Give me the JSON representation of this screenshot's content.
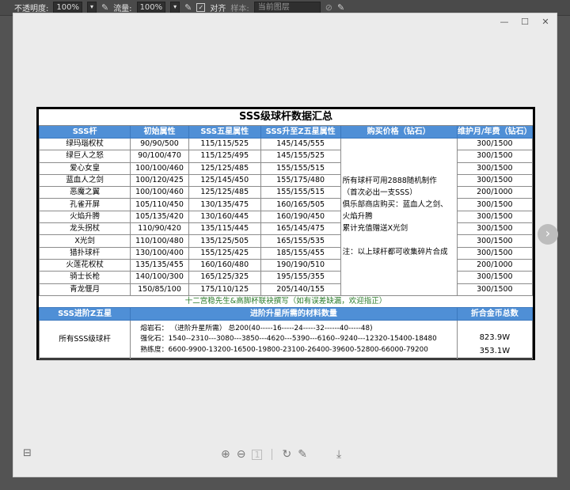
{
  "toolbar": {
    "opacity_label": "不透明度:",
    "opacity_value": "100%",
    "flow_label": "流量:",
    "flow_value": "100%",
    "align_label": "对齐",
    "sample_label": "样本:",
    "sample_value": "当前图层"
  },
  "sheet": {
    "title": "SSS级球杆数据汇总",
    "headers": [
      "SSS杆",
      "初始属性",
      "SSS五星属性",
      "SSS升至Z五星属性",
      "购买价格（钻石）",
      "维护月/年费（钻石）"
    ],
    "rows": [
      {
        "name": "绿玛瑙权杖",
        "base": "90/90/500",
        "five": "115/115/525",
        "z": "145/145/555",
        "fee": "300/1500"
      },
      {
        "name": "绿巨人之怒",
        "base": "90/100/470",
        "five": "115/125/495",
        "z": "145/155/525",
        "fee": "300/1500"
      },
      {
        "name": "爱心女皇",
        "base": "100/100/460",
        "five": "125/125/485",
        "z": "155/155/515",
        "fee": "300/1500"
      },
      {
        "name": "蓝血人之剑",
        "base": "100/120/425",
        "five": "125/145/450",
        "z": "155/175/480",
        "fee": "300/1500"
      },
      {
        "name": "恶魔之翼",
        "base": "100/100/460",
        "five": "125/125/485",
        "z": "155/155/515",
        "fee": "200/1000"
      },
      {
        "name": "孔雀开屏",
        "base": "105/110/450",
        "five": "130/135/475",
        "z": "160/165/505",
        "fee": "300/1500"
      },
      {
        "name": "火焰升腾",
        "base": "105/135/420",
        "five": "130/160/445",
        "z": "160/190/450",
        "fee": "300/1500"
      },
      {
        "name": "龙头拐杖",
        "base": "110/90/420",
        "five": "135/115/445",
        "z": "165/145/475",
        "fee": "300/1500"
      },
      {
        "name": "X光剑",
        "base": "110/100/480",
        "five": "135/125/505",
        "z": "165/155/535",
        "fee": "300/1500"
      },
      {
        "name": "猎扑球杆",
        "base": "130/100/400",
        "five": "155/125/425",
        "z": "185/155/455",
        "fee": "300/1500"
      },
      {
        "name": "火莲花权杖",
        "base": "135/135/455",
        "five": "160/160/480",
        "z": "190/190/510",
        "fee": "200/1000"
      },
      {
        "name": "骑士长枪",
        "base": "140/100/300",
        "five": "165/125/325",
        "z": "195/155/355",
        "fee": "300/1500"
      },
      {
        "name": "青龙偃月",
        "base": "150/85/100",
        "five": "175/110/125",
        "z": "205/140/155",
        "fee": "300/1500"
      }
    ],
    "price_lines": [
      "所有球杆可用2888随机制作",
      "（首次必出一支SSS）",
      "俱乐部商店购买：蓝血人之剑、",
      "火焰升腾",
      "累计充值赠送X光剑",
      "",
      "注：以上球杆都可收集碎片合成"
    ],
    "credit": "十二宫稳先生&高脚杯联袂撰写（如有误差缺漏，欢迎指正）",
    "section2_headers": [
      "SSS进阶Z五星",
      "进阶升星所需的材料数量",
      "折合金币总数"
    ],
    "section2_item": "所有SSS级球杆",
    "materials": [
      "熔岩石：   （进阶升星所需）              总200(40-----16-----24-----32------40-----48)",
      "强化石：1540--2310---3080---3850---4620---5390---6160--9240---12320-15400-18480",
      "熟练度：6600-9900-13200-16500-19800-23100-26400-39600-52800-66000-79200"
    ],
    "gold": [
      "823.9W",
      "353.1W"
    ]
  }
}
